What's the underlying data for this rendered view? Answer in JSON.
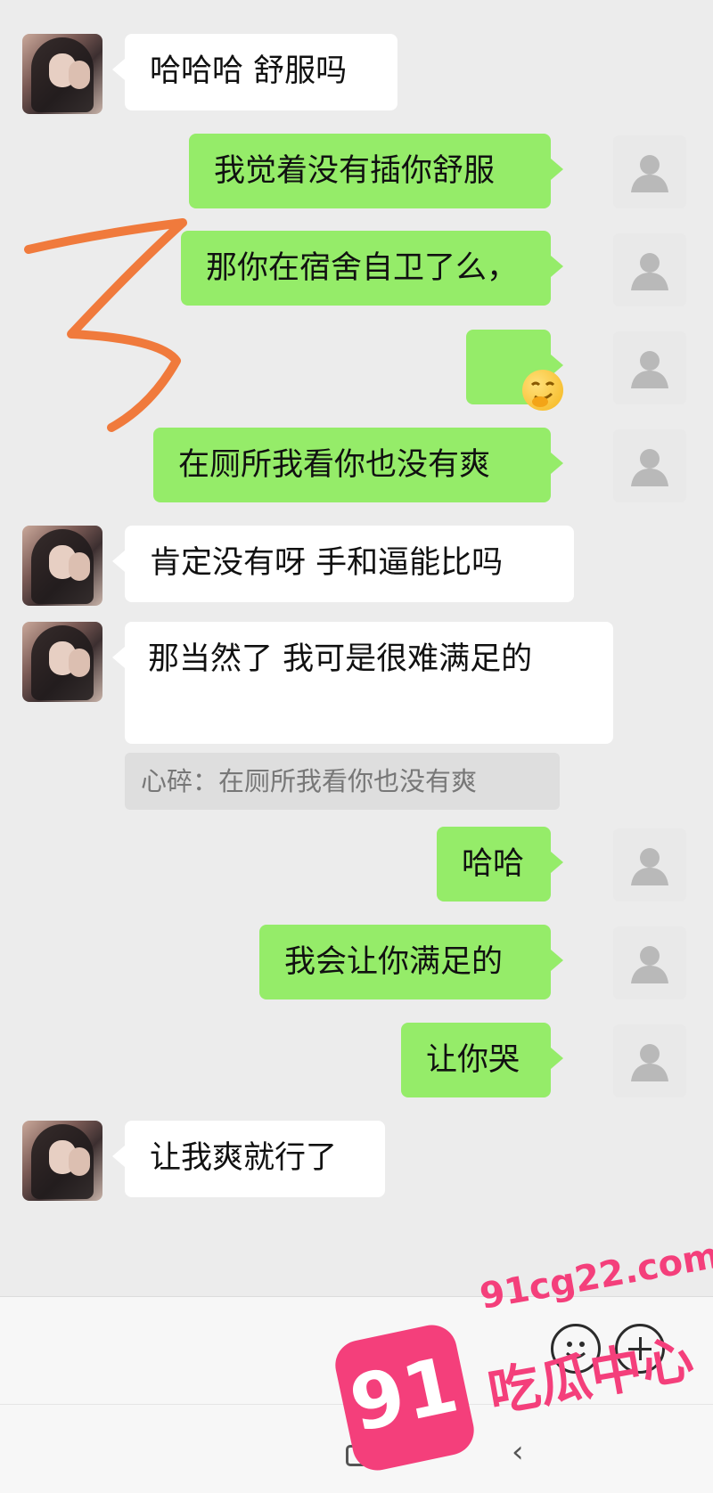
{
  "messages": [
    {
      "side": "in",
      "text": "哈哈哈 舒服吗"
    },
    {
      "side": "out",
      "text": "我觉着没有插你舒服"
    },
    {
      "side": "out",
      "text": "那你在宿舍自卫了么，"
    },
    {
      "side": "out",
      "text": "",
      "emoji": "smirk-face-emoji"
    },
    {
      "side": "out",
      "text": "在厕所我看你也没有爽"
    },
    {
      "side": "in",
      "text": "肯定没有呀 手和逼能比吗"
    },
    {
      "side": "in",
      "text": "那当然了   我可是很难满足的"
    },
    {
      "side": "out",
      "text": "哈哈"
    },
    {
      "side": "out",
      "text": "我会让你满足的"
    },
    {
      "side": "out",
      "text": "让你哭"
    },
    {
      "side": "in",
      "text": "让我爽就行了"
    }
  ],
  "quote": {
    "text": "心碎：在厕所我看你也没有爽"
  },
  "watermark": {
    "badge": "91",
    "url": "91cg22.com",
    "name": "吃瓜中心"
  },
  "colors": {
    "outgoing_bubble": "#95ec69",
    "incoming_bubble": "#ffffff",
    "background": "#ececec",
    "watermark": "#f43f7b",
    "scribble": "#f07a3c"
  },
  "icons": {
    "self_avatar": "default-user-icon",
    "emoji_button": "emoji-icon",
    "more_button": "plus-icon",
    "nav_home": "square-icon",
    "nav_back": "back-icon"
  }
}
